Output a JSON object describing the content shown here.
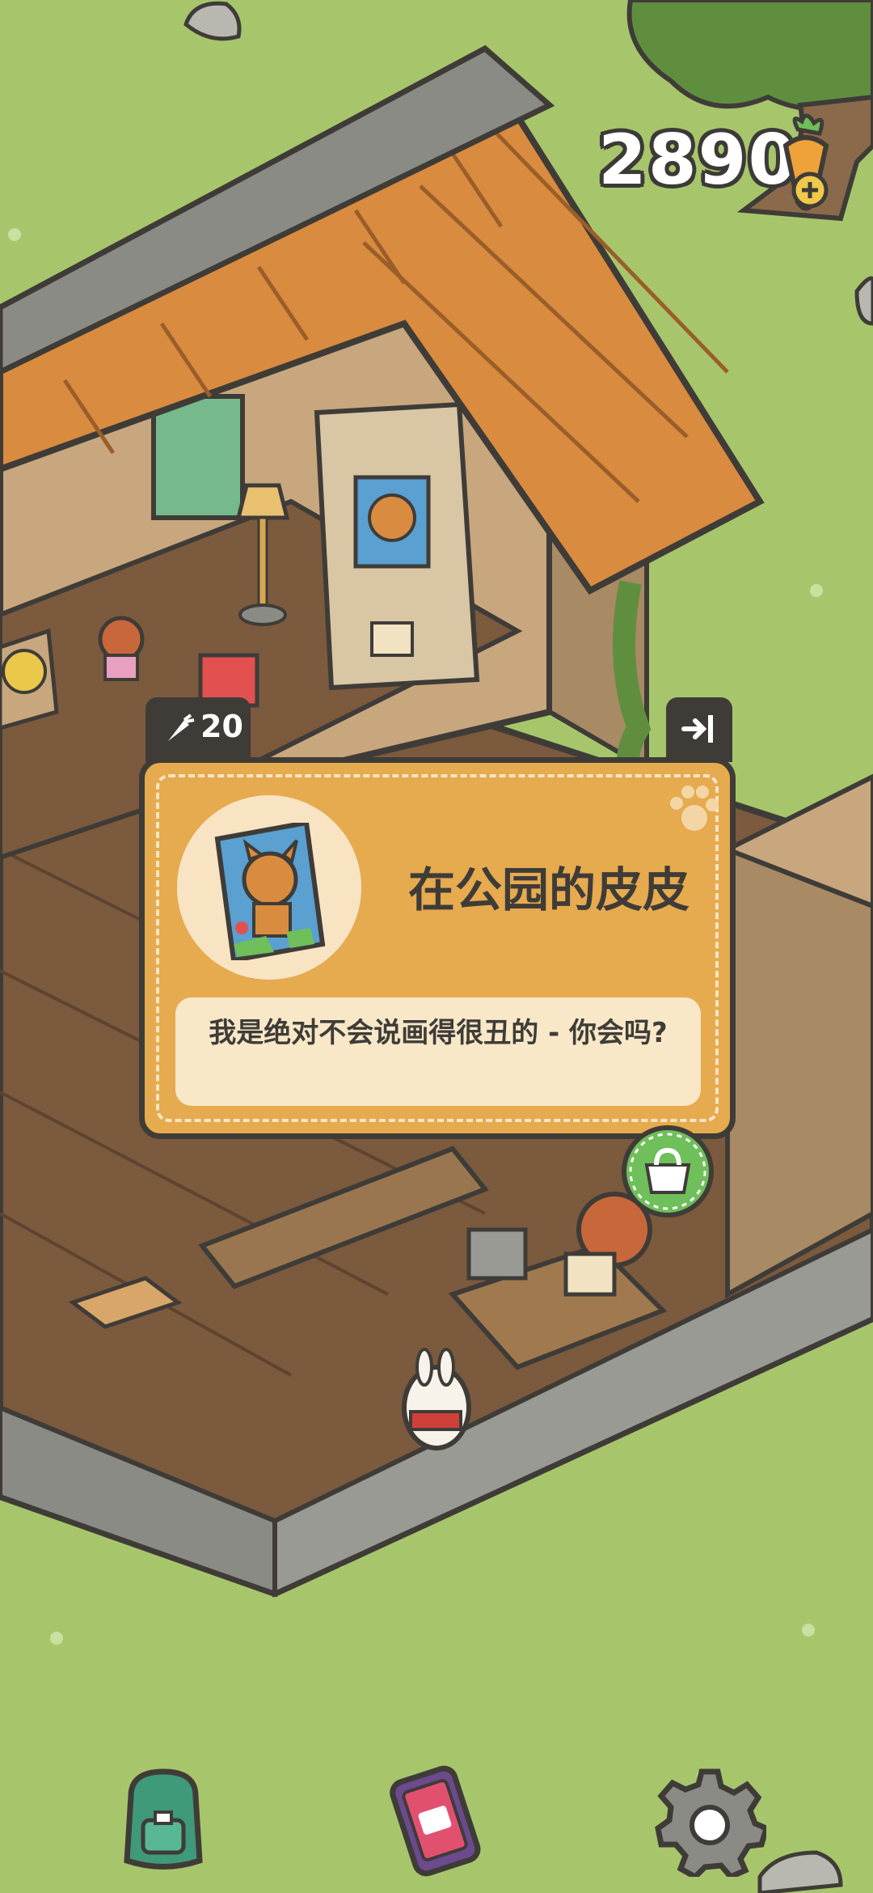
{
  "hud": {
    "carrot_count": "2890",
    "carrot_icon": "carrot-add-icon"
  },
  "dialog": {
    "cost": "20",
    "cost_icon": "carrot-icon",
    "exit_icon": "exit-icon",
    "decor_icon": "paw-icon",
    "portrait_icon": "fox-painting-portrait",
    "name": "在公园的皮皮",
    "message": "我是绝对不会说画得很丑的 - 你会吗?"
  },
  "scene": {
    "shop_icon": "shopping-bag-icon"
  },
  "bottom_bar": {
    "items": [
      {
        "icon": "backpack-icon"
      },
      {
        "icon": "phone-menu-icon"
      },
      {
        "icon": "settings-gear-icon"
      }
    ]
  },
  "colors": {
    "grass": "#a7c66c",
    "floor": "#7b5a3e",
    "roof": "#d98b3f",
    "dialog_bg": "#e6aa4f",
    "dialog_border": "#3f3c38",
    "speech_bg": "#f8e8c8"
  }
}
